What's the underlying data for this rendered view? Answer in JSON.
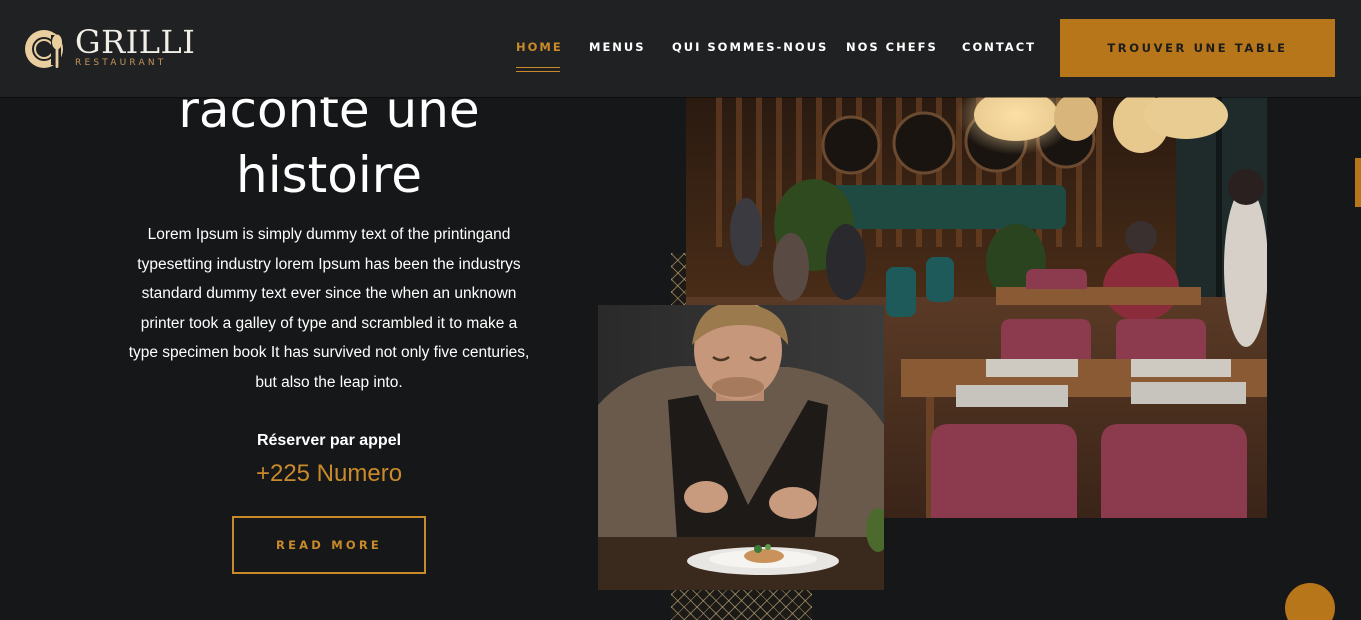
{
  "brand": {
    "name": "GRILLI",
    "tagline": "RESTAURANT",
    "logo_icon": "plate-and-spoon-icon"
  },
  "nav": {
    "items": [
      {
        "label": "HOME",
        "active": true
      },
      {
        "label": "MENUS",
        "active": false
      },
      {
        "label": "QUI SOMMES-NOUS",
        "active": false
      },
      {
        "label": "NOS CHEFS",
        "active": false
      },
      {
        "label": "CONTACT",
        "active": false
      }
    ],
    "cta_label": "TROUVER UNE TABLE"
  },
  "hero": {
    "heading_line1": "raconte une",
    "heading_line2": "histoire",
    "body_lines": [
      "Lorem Ipsum is simply dummy text of the printingand",
      "typesetting industry lorem Ipsum has been the industrys",
      "standard dummy text ever since the when an unknown",
      "printer took a galley of type and scrambled it to make a",
      "type specimen book It has survived not only five centuries,",
      "but also the leap into."
    ],
    "reserve_label": "Réserver par appel",
    "reserve_number": "+225 Numero",
    "read_more_label": "READ MORE"
  },
  "images": {
    "main_photo": "restaurant-interior-photo",
    "inset_photo": "chef-plating-photo"
  },
  "colors": {
    "accent": "#c88a2a",
    "button": "#b7761a",
    "background": "#161718",
    "header": "#202122",
    "text": "#ffffff"
  }
}
